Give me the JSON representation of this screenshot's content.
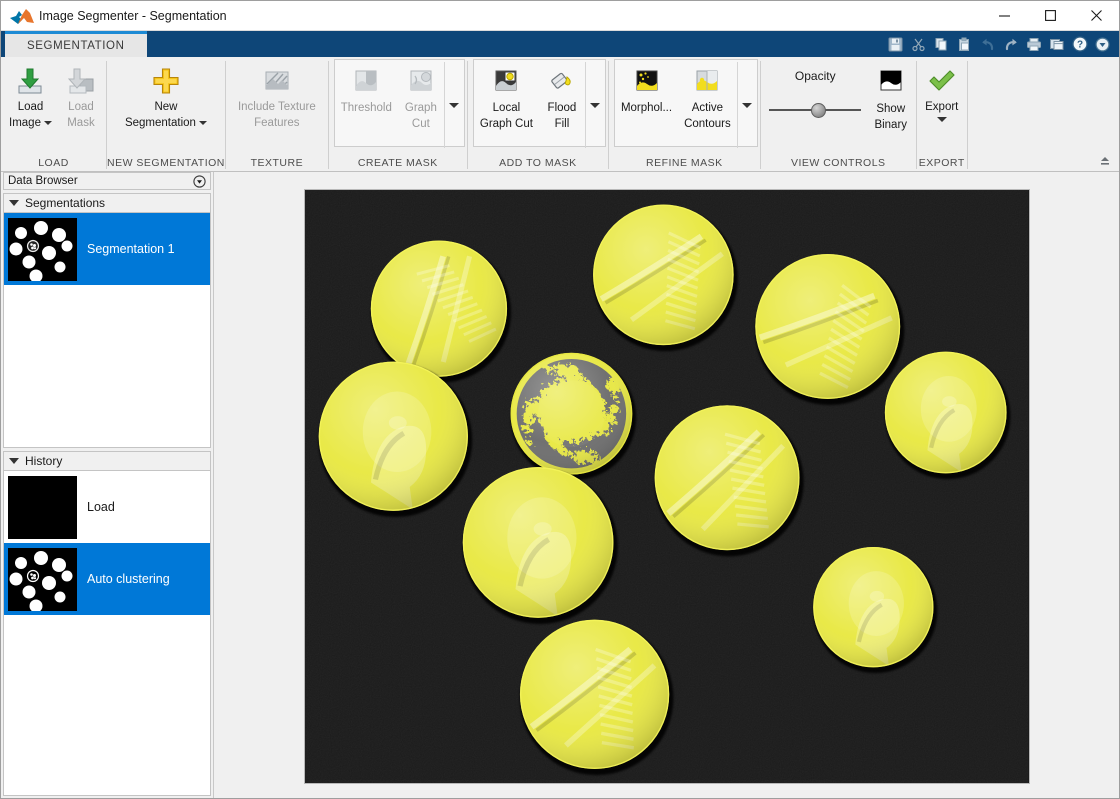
{
  "window": {
    "title": "Image Segmenter - Segmentation",
    "logo_name": "matlab-logo",
    "controls": {
      "minimize": "—",
      "maximize": "□",
      "close": "✕"
    }
  },
  "quick_access": {
    "items": [
      {
        "name": "save-icon",
        "label": "Save"
      },
      {
        "name": "cut-icon",
        "label": "Cut"
      },
      {
        "name": "copy-icon",
        "label": "Copy"
      },
      {
        "name": "paste-icon",
        "label": "Paste"
      },
      {
        "name": "undo-icon",
        "label": "Undo"
      },
      {
        "name": "redo-icon",
        "label": "Redo"
      },
      {
        "name": "print-icon",
        "label": "Print"
      },
      {
        "name": "layout-icon",
        "label": "Layout"
      },
      {
        "name": "help-icon",
        "label": "Help"
      },
      {
        "name": "qat-dropdown-icon",
        "label": "More"
      }
    ]
  },
  "ribbon": {
    "tab": "SEGMENTATION",
    "collapse_label": "Minimize Ribbon",
    "groups": [
      {
        "label": "LOAD",
        "buttons": [
          {
            "label_line1": "Load",
            "label_line2": "Image",
            "has_caret": true,
            "disabled": false,
            "icon": "load-image-icon"
          },
          {
            "label_line1": "Load",
            "label_line2": "Mask",
            "has_caret": false,
            "disabled": true,
            "icon": "load-mask-icon"
          }
        ]
      },
      {
        "label": "NEW SEGMENTATION",
        "buttons": [
          {
            "label_line1": "New",
            "label_line2": "Segmentation",
            "has_caret": true,
            "disabled": false,
            "icon": "new-segmentation-icon"
          }
        ]
      },
      {
        "label": "TEXTURE",
        "buttons": [
          {
            "label_line1": "Include Texture",
            "label_line2": "Features",
            "has_caret": false,
            "disabled": true,
            "icon": "texture-icon"
          }
        ]
      },
      {
        "label": "CREATE MASK",
        "buttons": [
          {
            "label_line1": "Threshold",
            "label_line2": "",
            "has_caret": false,
            "disabled": true,
            "icon": "threshold-icon"
          },
          {
            "label_line1": "Graph",
            "label_line2": "Cut",
            "has_caret": false,
            "disabled": true,
            "icon": "graph-cut-icon"
          }
        ]
      },
      {
        "label": "ADD TO MASK",
        "buttons": [
          {
            "label_line1": "Local",
            "label_line2": "Graph Cut",
            "has_caret": false,
            "disabled": false,
            "icon": "local-graph-cut-icon"
          },
          {
            "label_line1": "Flood",
            "label_line2": "Fill",
            "has_caret": false,
            "disabled": false,
            "icon": "flood-fill-icon"
          }
        ]
      },
      {
        "label": "REFINE MASK",
        "buttons": [
          {
            "label_line1": "Morphol...",
            "label_line2": "",
            "has_caret": false,
            "disabled": false,
            "icon": "morphology-icon"
          },
          {
            "label_line1": "Active",
            "label_line2": "Contours",
            "has_caret": false,
            "disabled": false,
            "icon": "active-contours-icon"
          }
        ]
      },
      {
        "label": "VIEW CONTROLS",
        "opacity_label": "Opacity",
        "opacity_value": 50,
        "buttons": [
          {
            "label_line1": "Show",
            "label_line2": "Binary",
            "has_caret": false,
            "disabled": false,
            "icon": "show-binary-icon"
          }
        ]
      },
      {
        "label": "EXPORT",
        "buttons": [
          {
            "label_line1": "Export",
            "label_line2": "",
            "has_caret": true,
            "disabled": false,
            "icon": "export-icon"
          }
        ]
      }
    ]
  },
  "data_browser": {
    "title": "Data Browser",
    "collapse_icon": "panel-dropdown-icon",
    "segmentations": {
      "title": "Segmentations",
      "items": [
        {
          "label": "Segmentation 1",
          "selected": true,
          "thumb": "mask-blobs"
        }
      ]
    },
    "history": {
      "title": "History",
      "items": [
        {
          "label": "Load",
          "selected": false,
          "thumb": "black"
        },
        {
          "label": "Auto clustering",
          "selected": true,
          "thumb": "mask-blobs"
        }
      ]
    }
  },
  "image_view": {
    "name": "coins-segmentation-overlay",
    "background_color": "#1b1b1b",
    "mask_color": "#E8E840",
    "unsegmented_color": "#6b6b6b",
    "coins": [
      {
        "cx": 0.185,
        "cy": 0.2,
        "r": 0.094,
        "ry": 0.116,
        "rot": -12,
        "segmented": true,
        "relief": "wheat"
      },
      {
        "cx": 0.495,
        "cy": 0.143,
        "r": 0.097,
        "ry": 0.119,
        "rot": 28,
        "segmented": true,
        "relief": "wheat"
      },
      {
        "cx": 0.722,
        "cy": 0.23,
        "r": 0.1,
        "ry": 0.122,
        "rot": 40,
        "segmented": true,
        "relief": "wheat"
      },
      {
        "cx": 0.122,
        "cy": 0.415,
        "r": 0.103,
        "ry": 0.126,
        "rot": 0,
        "segmented": true,
        "relief": "head"
      },
      {
        "cx": 0.368,
        "cy": 0.377,
        "r": 0.084,
        "ry": 0.103,
        "rot": 0,
        "segmented": false,
        "relief": "speckle"
      },
      {
        "cx": 0.885,
        "cy": 0.375,
        "r": 0.084,
        "ry": 0.103,
        "rot": 0,
        "segmented": true,
        "relief": "head"
      },
      {
        "cx": 0.583,
        "cy": 0.485,
        "r": 0.1,
        "ry": 0.122,
        "rot": 18,
        "segmented": true,
        "relief": "wheat"
      },
      {
        "cx": 0.322,
        "cy": 0.594,
        "r": 0.104,
        "ry": 0.127,
        "rot": 0,
        "segmented": true,
        "relief": "head"
      },
      {
        "cx": 0.785,
        "cy": 0.703,
        "r": 0.083,
        "ry": 0.102,
        "rot": 0,
        "segmented": true,
        "relief": "head"
      },
      {
        "cx": 0.4,
        "cy": 0.85,
        "r": 0.103,
        "ry": 0.126,
        "rot": 22,
        "segmented": true,
        "relief": "wheat"
      }
    ]
  }
}
